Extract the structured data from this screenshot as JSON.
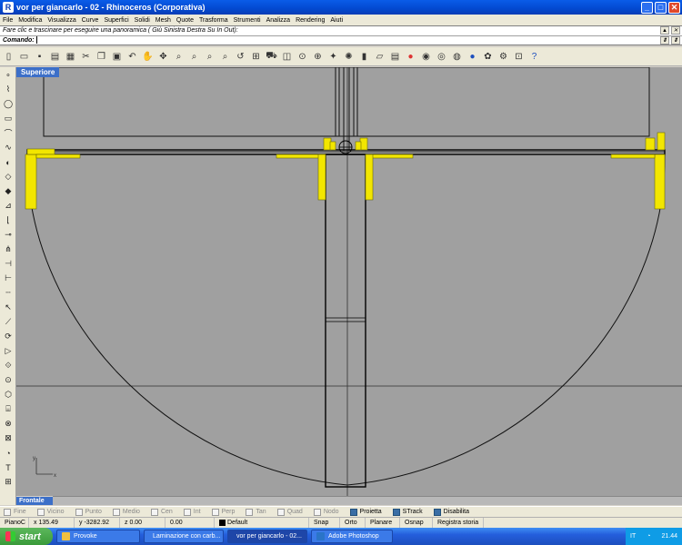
{
  "window": {
    "title": "vor per giancarlo - 02 - Rhinoceros (Corporativa)",
    "min": "_",
    "max": "□",
    "close": "✕"
  },
  "menu": [
    "File",
    "Modifica",
    "Visualizza",
    "Curve",
    "Superfici",
    "Solidi",
    "Mesh",
    "Quote",
    "Trasforma",
    "Strumenti",
    "Analizza",
    "Rendering",
    "Aiuti"
  ],
  "command": {
    "history": "Fare clic e trascinare per eseguire una panoramica ( Giù  Sinistra  Destra  Su  In  Out):",
    "prompt": "Comando:"
  },
  "viewports": {
    "top_label": "Superiore",
    "bottom_label": "Frontale"
  },
  "osnap": [
    {
      "label": "Fine",
      "checked": false
    },
    {
      "label": "Vicino",
      "checked": false
    },
    {
      "label": "Punto",
      "checked": false
    },
    {
      "label": "Medio",
      "checked": false
    },
    {
      "label": "Cen",
      "checked": false
    },
    {
      "label": "Int",
      "checked": false
    },
    {
      "label": "Perp",
      "checked": false
    },
    {
      "label": "Tan",
      "checked": false
    },
    {
      "label": "Quad",
      "checked": false
    },
    {
      "label": "Nodo",
      "checked": false
    },
    {
      "label": "Proietta",
      "checked": true
    },
    {
      "label": "STrack",
      "checked": true
    },
    {
      "label": "Disabilita",
      "checked": true
    }
  ],
  "status": {
    "cplane": "PianoC",
    "x": "x 135.49",
    "y": "y -3282.92",
    "z": "z 0.00",
    "dist": "0.00",
    "layer": "Default",
    "snap": "Snap",
    "orto": "Orto",
    "planare": "Planare",
    "osnap": "Osnap",
    "history": "Registra storia"
  },
  "taskbar": {
    "start": "start",
    "items": [
      "Provoke",
      "Laminazione con carb...",
      "vor per giancarlo - 02...",
      "Adobe Photoshop"
    ],
    "lang": "IT",
    "clock": "21.44"
  },
  "colors": {
    "viewport_bg": "#a0a0a0",
    "highlight": "#f2e600",
    "tab": "#3c6fc8"
  }
}
